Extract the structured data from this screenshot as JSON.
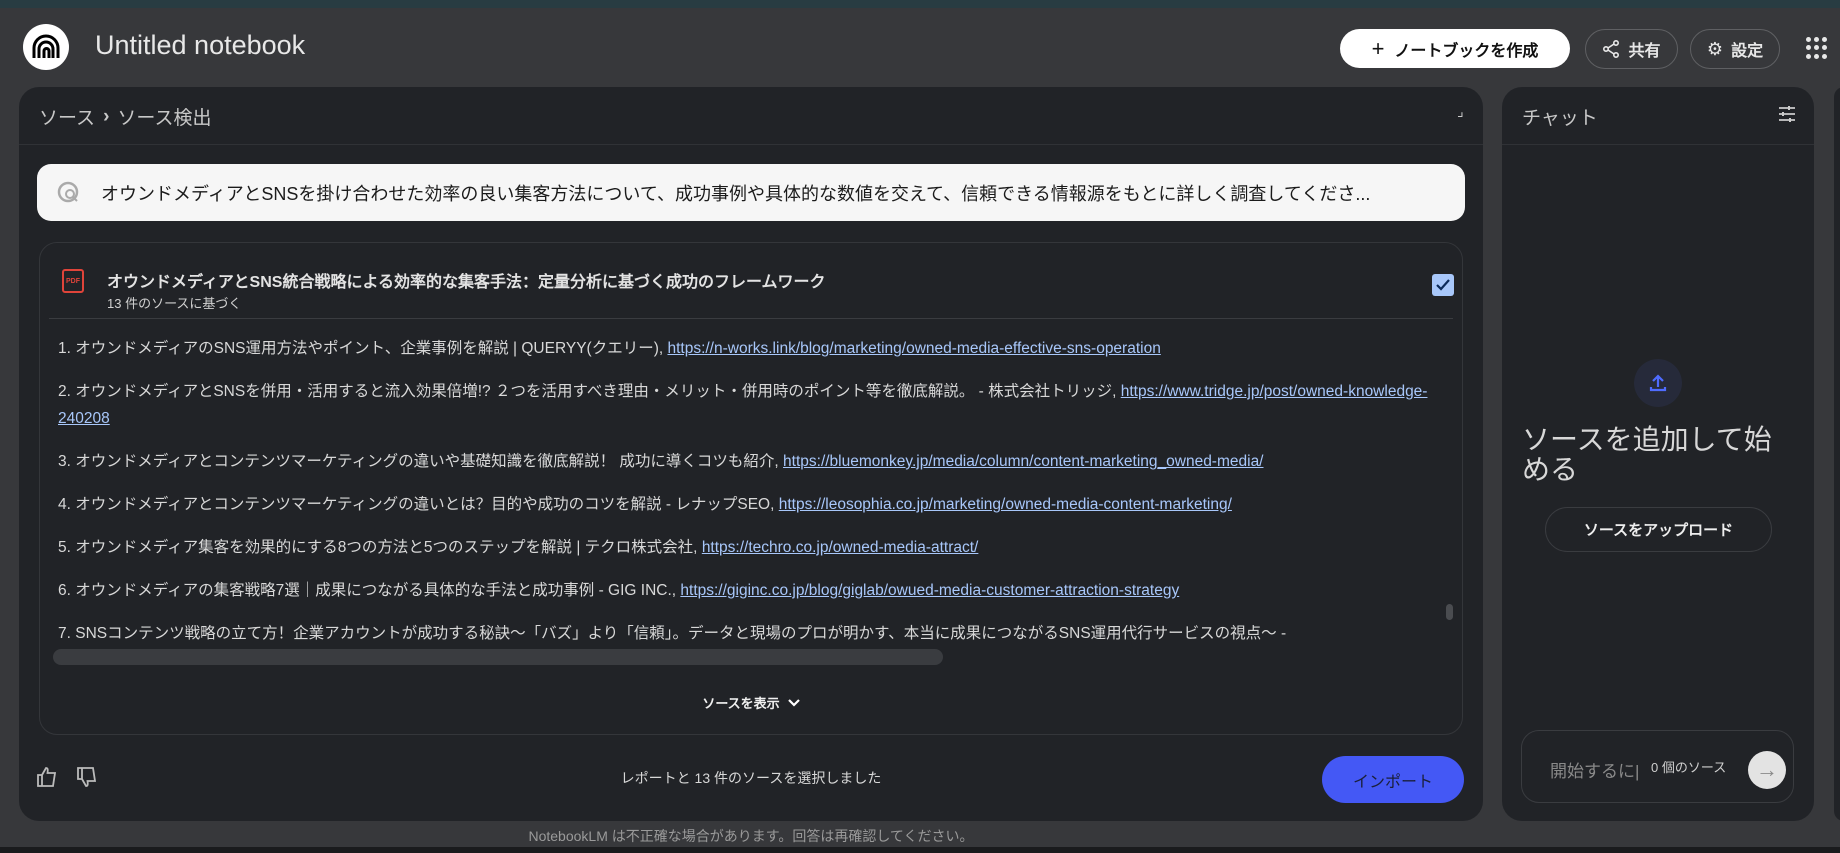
{
  "header": {
    "title": "Untitled notebook",
    "create_label": "ノートブックを作成",
    "share_label": "共有",
    "settings_label": "設定"
  },
  "sources_panel": {
    "breadcrumb_root": "ソース",
    "breadcrumb_current": "ソース検出",
    "query": "オウンドメディアとSNSを掛け合わせた効率の良い集客方法について、成功事例や具体的な数値を交えて、信頼できる情報源をもとに詳しく調査してくださ...",
    "report": {
      "title": "オウンドメディアとSNS統合戦略による効率的な集客手法：定量分析に基づく成功のフレームワーク",
      "subtitle": "13 件のソースに基づく",
      "checked": true,
      "icon_label": "PDF"
    },
    "sources": [
      {
        "text": "1. オウンドメディアのSNS運用方法やポイント、企業事例を解説 | QUERYY(クエリー), ",
        "url": "https://n-works.link/blog/marketing/owned-media-effective-sns-operation"
      },
      {
        "text": "2. オウンドメディアとSNSを併用・活用すると流入効果倍増!? ２つを活用すべき理由・メリット・併用時のポイント等を徹底解説。 - 株式会社トリッジ, ",
        "url": "https://www.tridge.jp/post/owned-knowledge-240208"
      },
      {
        "text": "3. オウンドメディアとコンテンツマーケティングの違いや基礎知識を徹底解説！ 成功に導くコツも紹介, ",
        "url": "https://bluemonkey.jp/media/column/content-marketing_owned-media/"
      },
      {
        "text": "4. オウンドメディアとコンテンツマーケティングの違いとは？目的や成功のコツを解説 - レナップSEO, ",
        "url": "https://leosophia.co.jp/marketing/owned-media-content-marketing/"
      },
      {
        "text": "5. オウンドメディア集客を効果的にする8つの方法と5つのステップを解説 | テクロ株式会社, ",
        "url": "https://techro.co.jp/owned-media-attract/"
      },
      {
        "text": "6. オウンドメディアの集客戦略7選｜成果につながる具体的な手法と成功事例 - GIG INC., ",
        "url": "https://giginc.co.jp/blog/giglab/owued-media-customer-attraction-strategy"
      },
      {
        "text": "7. SNSコンテンツ戦略の立て方！企業アカウントが成功する秘訣〜「バズ」より「信頼」。データと現場のプロが明かす、本当に成果につながるSNS運用代行サービスの視点〜 -",
        "url": ""
      }
    ],
    "show_sources_label": "ソースを表示",
    "status": "レポートと 13 件のソースを選択しました",
    "import_label": "インポート"
  },
  "chat_panel": {
    "title": "チャット",
    "heading": "ソースを追加して始める",
    "upload_label": "ソースをアップロード",
    "input_placeholder": "開始するに|",
    "source_count": "0 個のソース"
  },
  "footer": {
    "disclaimer": "NotebookLM は不正確な場合があります。回答は再確認してください。"
  },
  "colors": {
    "accent": "#4458f5",
    "link": "#a8c7fa",
    "panel": "#212327",
    "background": "#37383b"
  }
}
